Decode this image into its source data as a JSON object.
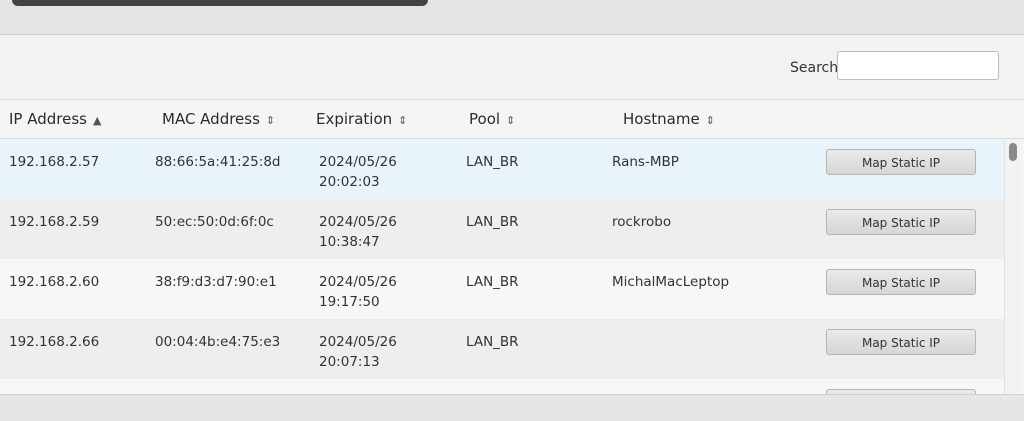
{
  "search": {
    "label": "Search",
    "value": ""
  },
  "columns": [
    {
      "label": "IP Address",
      "sort_icon": "triangle-up"
    },
    {
      "label": "MAC Address",
      "sort_icon": "sort-up-down"
    },
    {
      "label": "Expiration",
      "sort_icon": "sort-up-down"
    },
    {
      "label": "Pool",
      "sort_icon": "sort-up-down"
    },
    {
      "label": "Hostname",
      "sort_icon": "sort-up-down"
    }
  ],
  "leases": [
    {
      "ip": "192.168.2.57",
      "mac": "88:66:5a:41:25:8d",
      "exp_date": "2024/05/26",
      "exp_time": "20:02:03",
      "pool": "LAN_BR",
      "hostname": "Rans-MBP",
      "action": "Map Static IP"
    },
    {
      "ip": "192.168.2.59",
      "mac": "50:ec:50:0d:6f:0c",
      "exp_date": "2024/05/26",
      "exp_time": "10:38:47",
      "pool": "LAN_BR",
      "hostname": "rockrobo",
      "action": "Map Static IP"
    },
    {
      "ip": "192.168.2.60",
      "mac": "38:f9:d3:d7:90:e1",
      "exp_date": "2024/05/26",
      "exp_time": "19:17:50",
      "pool": "LAN_BR",
      "hostname": "MichalMacLeptop",
      "action": "Map Static IP"
    },
    {
      "ip": "192.168.2.66",
      "mac": "00:04:4b:e4:75:e3",
      "exp_date": "2024/05/26",
      "exp_time": "20:07:13",
      "pool": "LAN_BR",
      "hostname": "",
      "action": "Map Static IP"
    }
  ]
}
